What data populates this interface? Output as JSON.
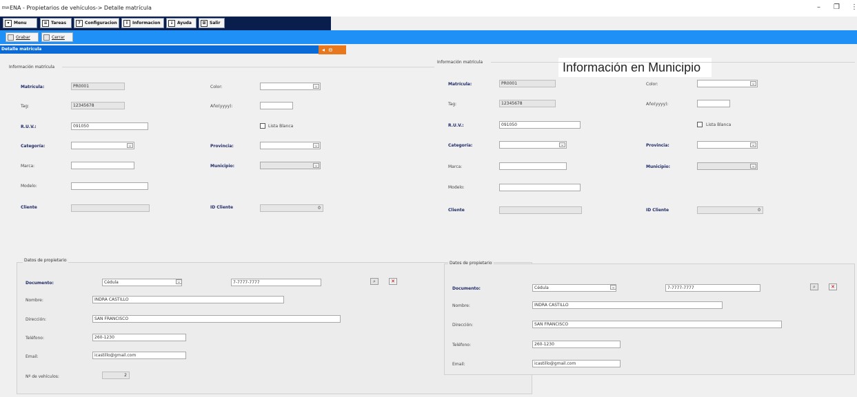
{
  "window": {
    "logo": "ENA",
    "title": "ENA - Propietarios de vehículos-> Detalle matrícula",
    "minimize": "–",
    "restore": "❐",
    "more": "⋮"
  },
  "menubar": {
    "items": [
      {
        "label": "Menu",
        "icon": "dropdown-icon"
      },
      {
        "label": "Tareas",
        "icon": "list-icon"
      },
      {
        "label": "Configuracion",
        "icon": "question-icon"
      },
      {
        "label": "Informacion",
        "icon": "info-icon"
      },
      {
        "label": "Ayuda",
        "icon": "help-icon"
      },
      {
        "label": "Salir",
        "icon": "exit-icon"
      }
    ]
  },
  "toolbar": {
    "save_label": "Grabar",
    "close_label": "Cerrar"
  },
  "detail": {
    "title": "Detalle matrícula",
    "tab_arrow": "◂",
    "tab_icon": "⊖"
  },
  "callout": "Información en Municipio",
  "form": {
    "section_title": "Información matrícula",
    "labels": {
      "matricula": "Matrícula:",
      "color": "Color:",
      "tag": "Tag:",
      "anio": "Año(yyyy):",
      "ruv": "R.U.V.:",
      "lista_blanca": "Lista Blanca",
      "categoria": "Categoría:",
      "provincia": "Provincia:",
      "marca": "Marca:",
      "municipio": "Municipio:",
      "modelo": "Modelo:",
      "cliente": "Cliente",
      "id_cliente": "ID Cliente"
    },
    "values": {
      "matricula": "PR0001",
      "tag": "12345678",
      "ruv": "091050",
      "id_cliente": "0"
    }
  },
  "owner": {
    "section_title": "Datos de propietario",
    "labels": {
      "documento": "Documento:",
      "nombre": "Nombre:",
      "direccion": "Dirección:",
      "telefono": "Teléfono:",
      "email": "Email:",
      "num_vehiculos": "Nº de vehículos:"
    },
    "values": {
      "tipo_documento": "Cédula",
      "documento": "7-7777-7777",
      "nombre": "INDRA CASTILLO",
      "direccion": "SAN FRANCISCO",
      "telefono": "260-1230",
      "email": "icastillo@gmail.com",
      "num_vehiculos": "2"
    }
  }
}
